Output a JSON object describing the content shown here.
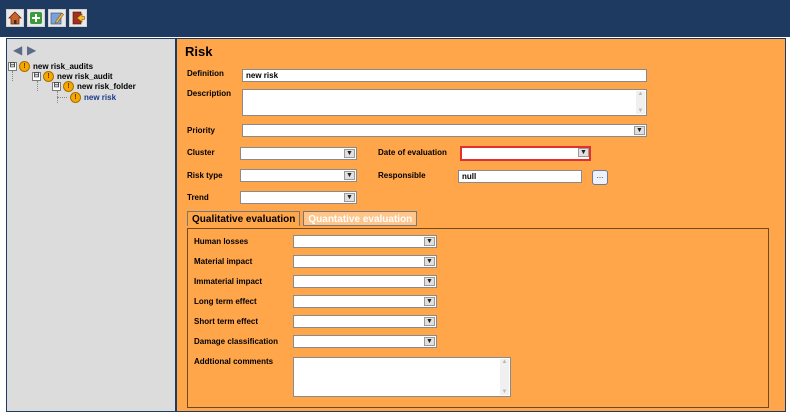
{
  "toolbar": {
    "icons": [
      "home-icon",
      "add-icon",
      "edit-icon",
      "exit-icon"
    ]
  },
  "tree": {
    "nav_back": "◀",
    "nav_forward": "▶",
    "expander_symbol": "⊟",
    "warning_symbol": "!",
    "items": [
      {
        "label": "new risk_audits"
      },
      {
        "label": "new risk_audit"
      },
      {
        "label": "new risk_folder"
      },
      {
        "label": "new risk",
        "color": "#1a3a8a"
      }
    ]
  },
  "form": {
    "title": "Risk",
    "definition_label": "Definition",
    "definition_value": "new risk",
    "description_label": "Description",
    "priority_label": "Priority",
    "cluster_label": "Cluster",
    "date_label": "Date of evaluation",
    "risk_type_label": "Risk type",
    "responsible_label": "Responsible",
    "responsible_value": "null",
    "browse_label": "...",
    "trend_label": "Trend",
    "dropdown_arrow": "▼",
    "scroll_up": "▲",
    "scroll_down": "▼"
  },
  "tabs": [
    {
      "label": "Qualitative evaluation",
      "active": true
    },
    {
      "label": "Quantative evaluation",
      "active": false
    }
  ],
  "qualitative": {
    "human_losses_label": "Human losses",
    "material_impact_label": "Material impact",
    "immaterial_impact_label": "Immaterial impact",
    "long_term_label": "Long term effect",
    "short_term_label": "Short term effect",
    "damage_label": "Damage classification",
    "comments_label": "Addtional comments"
  },
  "colors": {
    "topbar": "#1e3a60",
    "panel": "#ffa54a",
    "sidebar": "#dcdcdc",
    "error_border": "#e03030"
  }
}
